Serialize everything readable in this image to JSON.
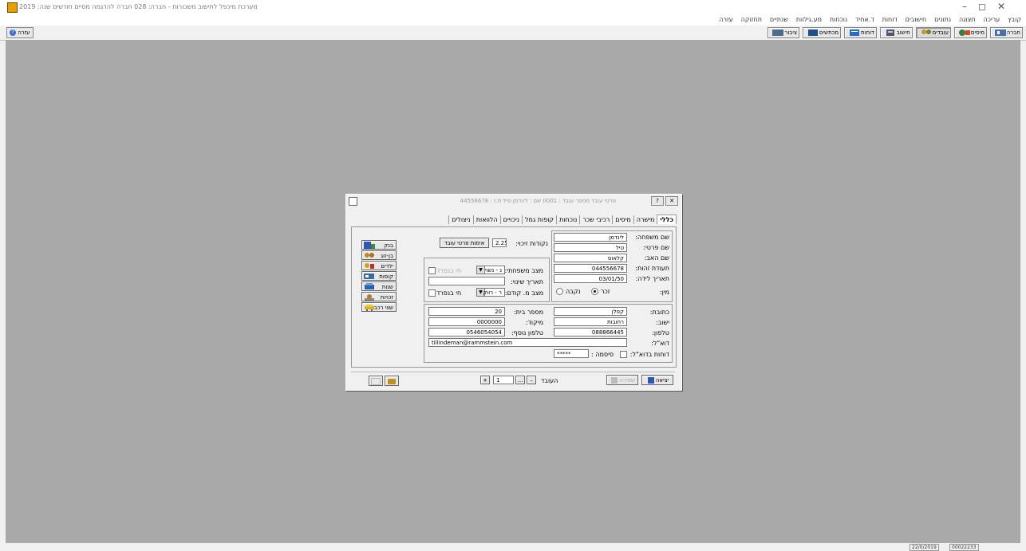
{
  "window": {
    "title": "מערכת מיכפל לחישוב משכורות - חברה: 028 חברה להדגמה מסיים חודשים  שנה: 2019",
    "controls": [
      "–",
      "◻",
      "✕"
    ]
  },
  "menu": [
    "קובץ",
    "עריכה",
    "תצוגה",
    "נתונים",
    "חישובים",
    "דוחות",
    "ד.אחיד",
    "נוכחות",
    "מע.גילוות",
    "שנתיים",
    "תחזוקה",
    "עזרה"
  ],
  "toolbar": {
    "buttons": [
      "חברה",
      "מיסים",
      "עובדים",
      "חישוב",
      "דוחות",
      "מכתשים",
      "ציבור"
    ],
    "help_label": "עזרה"
  },
  "dialog": {
    "title": "פרטי עובד    מספר עובד : 0001    שם : לינדמן טיל    ת.ז : 44556678",
    "tabs": [
      "כללי",
      "מישרה",
      "מיסים",
      "רכיבי שכר",
      "נוכחות",
      "קופות גמל",
      "ניכויים",
      "הלוואות",
      "ניצולים"
    ],
    "active_tab": "כללי",
    "fields": {
      "last_name": {
        "label": "שם משפחה:",
        "value": "לינדמן"
      },
      "first_name": {
        "label": "שם פרטי:",
        "value": "טיל"
      },
      "father_name": {
        "label": "שם האב:",
        "value": "קלאוס"
      },
      "id_number": {
        "label": "תעודת זהות:",
        "value": "044556678"
      },
      "birth_date": {
        "label": "תאריך לידה:",
        "value": "03/01/50"
      },
      "gender": {
        "label": "מין:",
        "male": "זכר",
        "female": "נקבה",
        "selected": "זכר"
      },
      "points": {
        "label": "נקודות זיכוי:",
        "value": "2.25"
      },
      "confirm_button": "אימות פרטי עובד",
      "marital_status": {
        "label": "מצב משפחתי:",
        "value": "נ - נשוי",
        "checkbox_label": "חי בנפרד"
      },
      "change_date": {
        "label": "תאריך שינוי:",
        "value": ""
      },
      "prev_status": {
        "label": "מצב מ. קודם:",
        "value": "ר - רווק",
        "checkbox_label": "חי בנפרד"
      },
      "address": {
        "label": "כתובת:",
        "value": "קפלן"
      },
      "house_number": {
        "label": "מספר בית:",
        "value": "20"
      },
      "city": {
        "label": "ישוב:",
        "value": "רחובות"
      },
      "zip": {
        "label": "מיקוד:",
        "value": "0000000"
      },
      "phone": {
        "label": "טלפון:",
        "value": "088866445"
      },
      "phone2": {
        "label": "טלפון נוסף:",
        "value": "0546054054"
      },
      "email": {
        "label": "דוא\"ל:",
        "value": "tillindeman@rammstein.com"
      },
      "email_reports": {
        "label": "דוחות בדוא\"ל:",
        "password_label": "סיסמה :",
        "password": "*****"
      }
    },
    "side_buttons": [
      "בנק",
      "בן-זוג",
      "ילדים",
      "קופות",
      "שנות",
      "זכויות",
      "שווי רכב"
    ],
    "bottom": {
      "exit": "יציאה",
      "save": "שמירה",
      "employee_label": "העובד",
      "employee_number": "1"
    }
  },
  "status": {
    "date": "22/0/2019",
    "code": "00022233"
  }
}
